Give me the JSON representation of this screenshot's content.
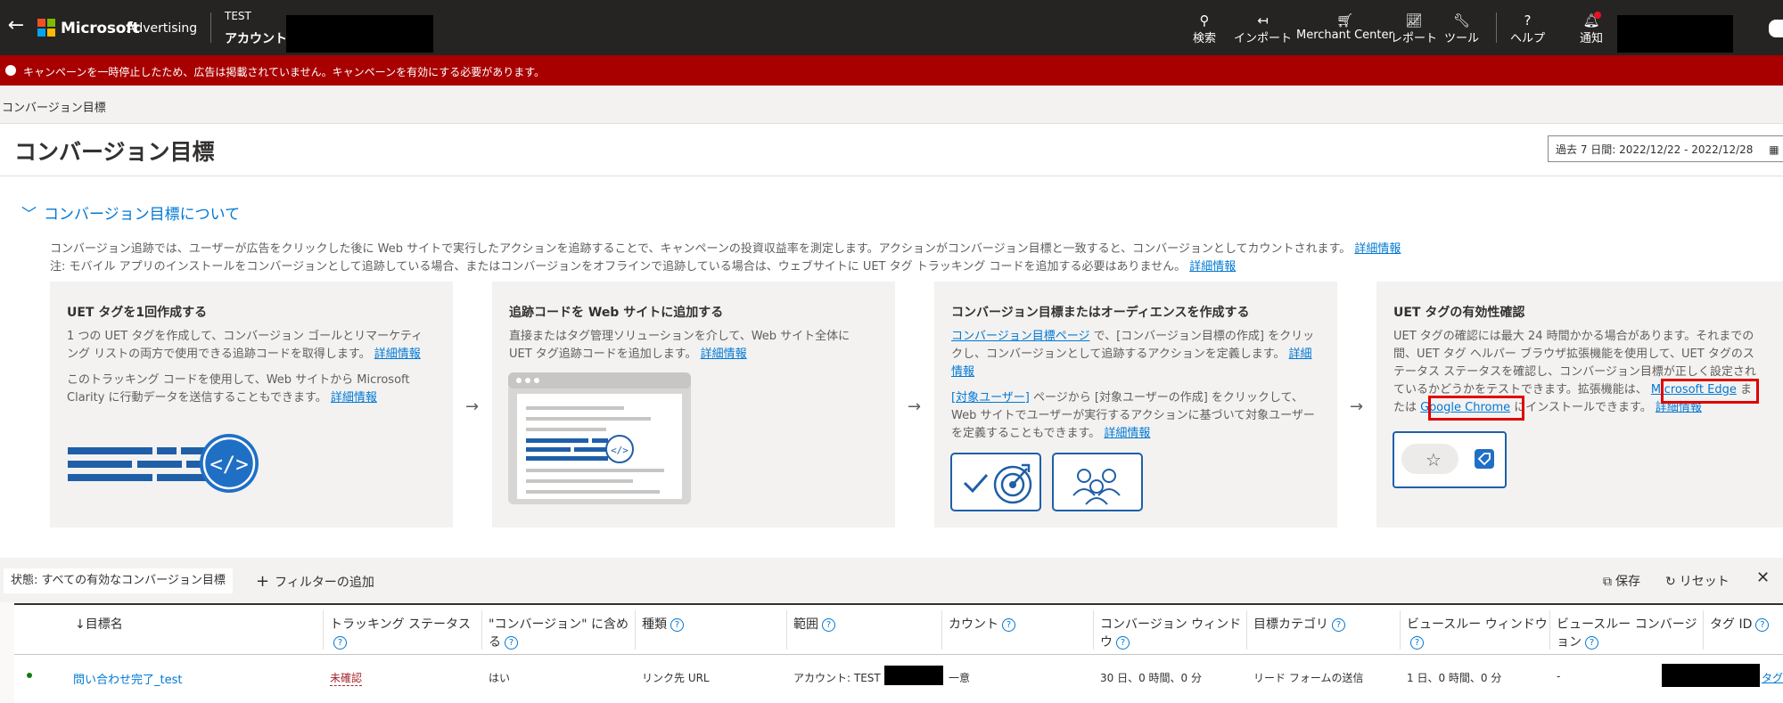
{
  "topbar": {
    "brand": "Microsoft",
    "product": "Advertising",
    "account_label": "TEST",
    "account_name": "アカウント",
    "items": [
      {
        "icon": "search-icon",
        "label": "検索"
      },
      {
        "icon": "import-icon",
        "label": "インポート"
      },
      {
        "icon": "cart-icon",
        "label": "Merchant Center"
      },
      {
        "icon": "chart-icon",
        "label": "レポート"
      },
      {
        "icon": "wrench-icon",
        "label": "ツール"
      },
      {
        "icon": "help-icon",
        "label": "ヘルプ"
      },
      {
        "icon": "bell-icon",
        "label": "通知"
      }
    ]
  },
  "alert": {
    "text": "キャンペーンを一時停止したため、広告は掲載されていません。キャンペーンを有効にする必要があります。",
    "color": "#a80000"
  },
  "breadcrumb": "コンバージョン目標",
  "header": {
    "title": "コンバージョン目標",
    "date_range": "過去 7 日間: 2022/12/22 - 2022/12/28"
  },
  "about": {
    "toggle": "コンバージョン目標について",
    "line1": "コンバージョン追跡では、ユーザーが広告をクリックした後に Web サイトで実行したアクションを追跡することで、キャンペーンの投資収益率を測定します。アクションがコンバージョン目標と一致すると、コンバージョンとしてカウントされます。",
    "line2": "注: モバイル アプリのインストールをコンバージョンとして追跡している場合、またはコンバージョンをオフラインで追跡している場合は、ウェブサイトに UET タグ トラッキング コードを追加する必要はありません。",
    "more": "詳細情報",
    "cards": [
      {
        "title": "UET タグを1回作成する",
        "p1": "1 つの UET タグを作成して、コンバージョン ゴールとリマーケティング リストの両方で使用できる追跡コードを取得します。",
        "p2": "このトラッキング コードを使用して、Web サイトから Microsoft Clarity に行動データを送信することもできます。"
      },
      {
        "title": "追跡コードを Web サイトに追加する",
        "p1": "直接またはタグ管理ソリューションを介して、Web サイト全体に UET タグ追跡コードを追加します。"
      },
      {
        "title": "コンバージョン目標またはオーディエンスを作成する",
        "p1_link": "コンバージョン目標ページ",
        "p1": "で、[コンバージョン目標の作成] をクリックし、コンバージョンとして追跡するアクションを定義します。",
        "p2_link": "[対象ユーザー]",
        "p2": "ページから [対象ユーザーの作成] をクリックして、Web サイトでユーザーが実行するアクションに基づいて対象ユーザーを定義することもできます。"
      },
      {
        "title": "UET タグの有効性確認",
        "p1": "UET タグの確認には最大 24 時間かかる場合があります。それまでの間、UET タグ ヘルパー ブラウザ拡張機能を使用して、UET タグのステータス ステータスを確認し、コンバージョン目標が正しく設定されているかどうかをテストできます。拡張機能は、",
        "edge": "Microsoft Edge",
        "or": "または",
        "chrome": "Google Chrome",
        "install": "にインストールできます。"
      }
    ]
  },
  "filterbar": {
    "state": "状態: すべての有効なコンバージョン目標",
    "add_filter": "フィルターの追加",
    "save": "保存",
    "reset": "リセット"
  },
  "table": {
    "headers": [
      "↓目標名",
      "トラッキング ステータス",
      "\"コンバージョン\" に含める",
      "種類",
      "範囲",
      "カウント",
      "コンバージョン ウィンドウ",
      "目標カテゴリ",
      "ビュースルー ウィンドウ",
      "ビュースルー コンバージョン",
      "タグ ID"
    ],
    "row": {
      "name": "問い合わせ完了_test",
      "status": "未確認",
      "include": "はい",
      "type": "リンク先 URL",
      "scope": "アカウント: TEST",
      "count": "一意",
      "window": "30 日、0 時間、0 分",
      "category": "リード フォームの送信",
      "view_window": "1 日、0 時間、0 分",
      "view_conv": "-",
      "tag": "タグ"
    }
  }
}
